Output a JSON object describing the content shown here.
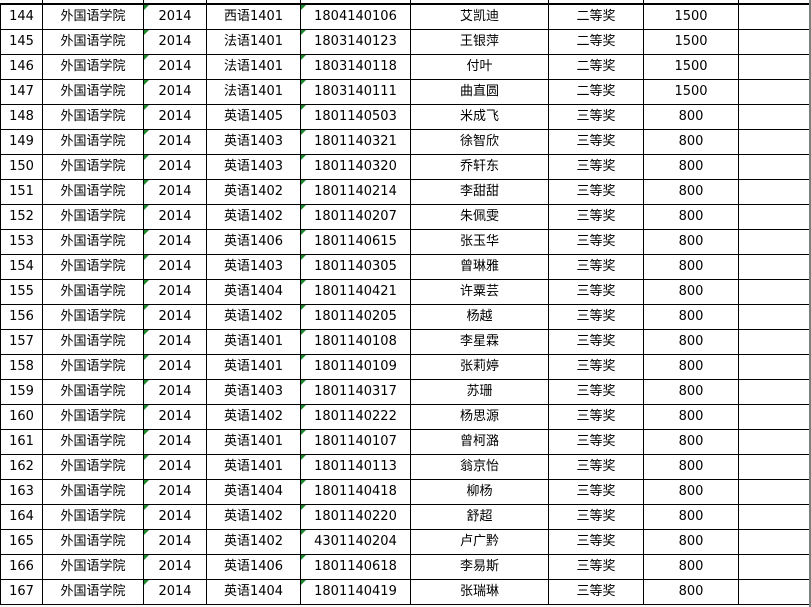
{
  "rows": [
    {
      "no": "144",
      "college": "外国语学院",
      "year": "2014",
      "class": "西语1401",
      "student_id": "1804140106",
      "name": "艾凯迪",
      "award": "二等奖",
      "amount": "1500",
      "note": ""
    },
    {
      "no": "145",
      "college": "外国语学院",
      "year": "2014",
      "class": "法语1401",
      "student_id": "1803140123",
      "name": "王银萍",
      "award": "二等奖",
      "amount": "1500",
      "note": ""
    },
    {
      "no": "146",
      "college": "外国语学院",
      "year": "2014",
      "class": "法语1401",
      "student_id": "1803140118",
      "name": "付叶",
      "award": "二等奖",
      "amount": "1500",
      "note": ""
    },
    {
      "no": "147",
      "college": "外国语学院",
      "year": "2014",
      "class": "法语1401",
      "student_id": "1803140111",
      "name": "曲直圆",
      "award": "二等奖",
      "amount": "1500",
      "note": ""
    },
    {
      "no": "148",
      "college": "外国语学院",
      "year": "2014",
      "class": "英语1405",
      "student_id": "1801140503",
      "name": "米成飞",
      "award": "三等奖",
      "amount": "800",
      "note": ""
    },
    {
      "no": "149",
      "college": "外国语学院",
      "year": "2014",
      "class": "英语1403",
      "student_id": "1801140321",
      "name": "徐智欣",
      "award": "三等奖",
      "amount": "800",
      "note": ""
    },
    {
      "no": "150",
      "college": "外国语学院",
      "year": "2014",
      "class": "英语1403",
      "student_id": "1801140320",
      "name": "乔轩东",
      "award": "三等奖",
      "amount": "800",
      "note": ""
    },
    {
      "no": "151",
      "college": "外国语学院",
      "year": "2014",
      "class": "英语1402",
      "student_id": "1801140214",
      "name": "李甜甜",
      "award": "三等奖",
      "amount": "800",
      "note": ""
    },
    {
      "no": "152",
      "college": "外国语学院",
      "year": "2014",
      "class": "英语1402",
      "student_id": "1801140207",
      "name": "朱佩雯",
      "award": "三等奖",
      "amount": "800",
      "note": ""
    },
    {
      "no": "153",
      "college": "外国语学院",
      "year": "2014",
      "class": "英语1406",
      "student_id": "1801140615",
      "name": "张玉华",
      "award": "三等奖",
      "amount": "800",
      "note": ""
    },
    {
      "no": "154",
      "college": "外国语学院",
      "year": "2014",
      "class": "英语1403",
      "student_id": "1801140305",
      "name": "曾琳雅",
      "award": "三等奖",
      "amount": "800",
      "note": ""
    },
    {
      "no": "155",
      "college": "外国语学院",
      "year": "2014",
      "class": "英语1404",
      "student_id": "1801140421",
      "name": "许粟芸",
      "award": "三等奖",
      "amount": "800",
      "note": ""
    },
    {
      "no": "156",
      "college": "外国语学院",
      "year": "2014",
      "class": "英语1402",
      "student_id": "1801140205",
      "name": "杨越",
      "award": "三等奖",
      "amount": "800",
      "note": ""
    },
    {
      "no": "157",
      "college": "外国语学院",
      "year": "2014",
      "class": "英语1401",
      "student_id": "1801140108",
      "name": "李星霖",
      "award": "三等奖",
      "amount": "800",
      "note": ""
    },
    {
      "no": "158",
      "college": "外国语学院",
      "year": "2014",
      "class": "英语1401",
      "student_id": "1801140109",
      "name": "张莉婷",
      "award": "三等奖",
      "amount": "800",
      "note": ""
    },
    {
      "no": "159",
      "college": "外国语学院",
      "year": "2014",
      "class": "英语1403",
      "student_id": "1801140317",
      "name": "苏珊",
      "award": "三等奖",
      "amount": "800",
      "note": ""
    },
    {
      "no": "160",
      "college": "外国语学院",
      "year": "2014",
      "class": "英语1402",
      "student_id": "1801140222",
      "name": "杨思源",
      "award": "三等奖",
      "amount": "800",
      "note": ""
    },
    {
      "no": "161",
      "college": "外国语学院",
      "year": "2014",
      "class": "英语1401",
      "student_id": "1801140107",
      "name": "曾柯潞",
      "award": "三等奖",
      "amount": "800",
      "note": ""
    },
    {
      "no": "162",
      "college": "外国语学院",
      "year": "2014",
      "class": "英语1401",
      "student_id": "1801140113",
      "name": "翁京怡",
      "award": "三等奖",
      "amount": "800",
      "note": ""
    },
    {
      "no": "163",
      "college": "外国语学院",
      "year": "2014",
      "class": "英语1404",
      "student_id": "1801140418",
      "name": "柳杨",
      "award": "三等奖",
      "amount": "800",
      "note": ""
    },
    {
      "no": "164",
      "college": "外国语学院",
      "year": "2014",
      "class": "英语1402",
      "student_id": "1801140220",
      "name": "舒超",
      "award": "三等奖",
      "amount": "800",
      "note": ""
    },
    {
      "no": "165",
      "college": "外国语学院",
      "year": "2014",
      "class": "英语1402",
      "student_id": "4301140204",
      "name": "卢广黔",
      "award": "三等奖",
      "amount": "800",
      "note": ""
    },
    {
      "no": "166",
      "college": "外国语学院",
      "year": "2014",
      "class": "英语1406",
      "student_id": "1801140618",
      "name": "李易斯",
      "award": "三等奖",
      "amount": "800",
      "note": ""
    },
    {
      "no": "167",
      "college": "外国语学院",
      "year": "2014",
      "class": "英语1404",
      "student_id": "1801140419",
      "name": "张瑞琳",
      "award": "三等奖",
      "amount": "800",
      "note": ""
    }
  ],
  "page_break_before_row": 19,
  "colors": {
    "grid_line": "#000000",
    "cell_marker": "#1f8a2c",
    "page_break": "#1a3cd6",
    "background": "#ffffff"
  }
}
